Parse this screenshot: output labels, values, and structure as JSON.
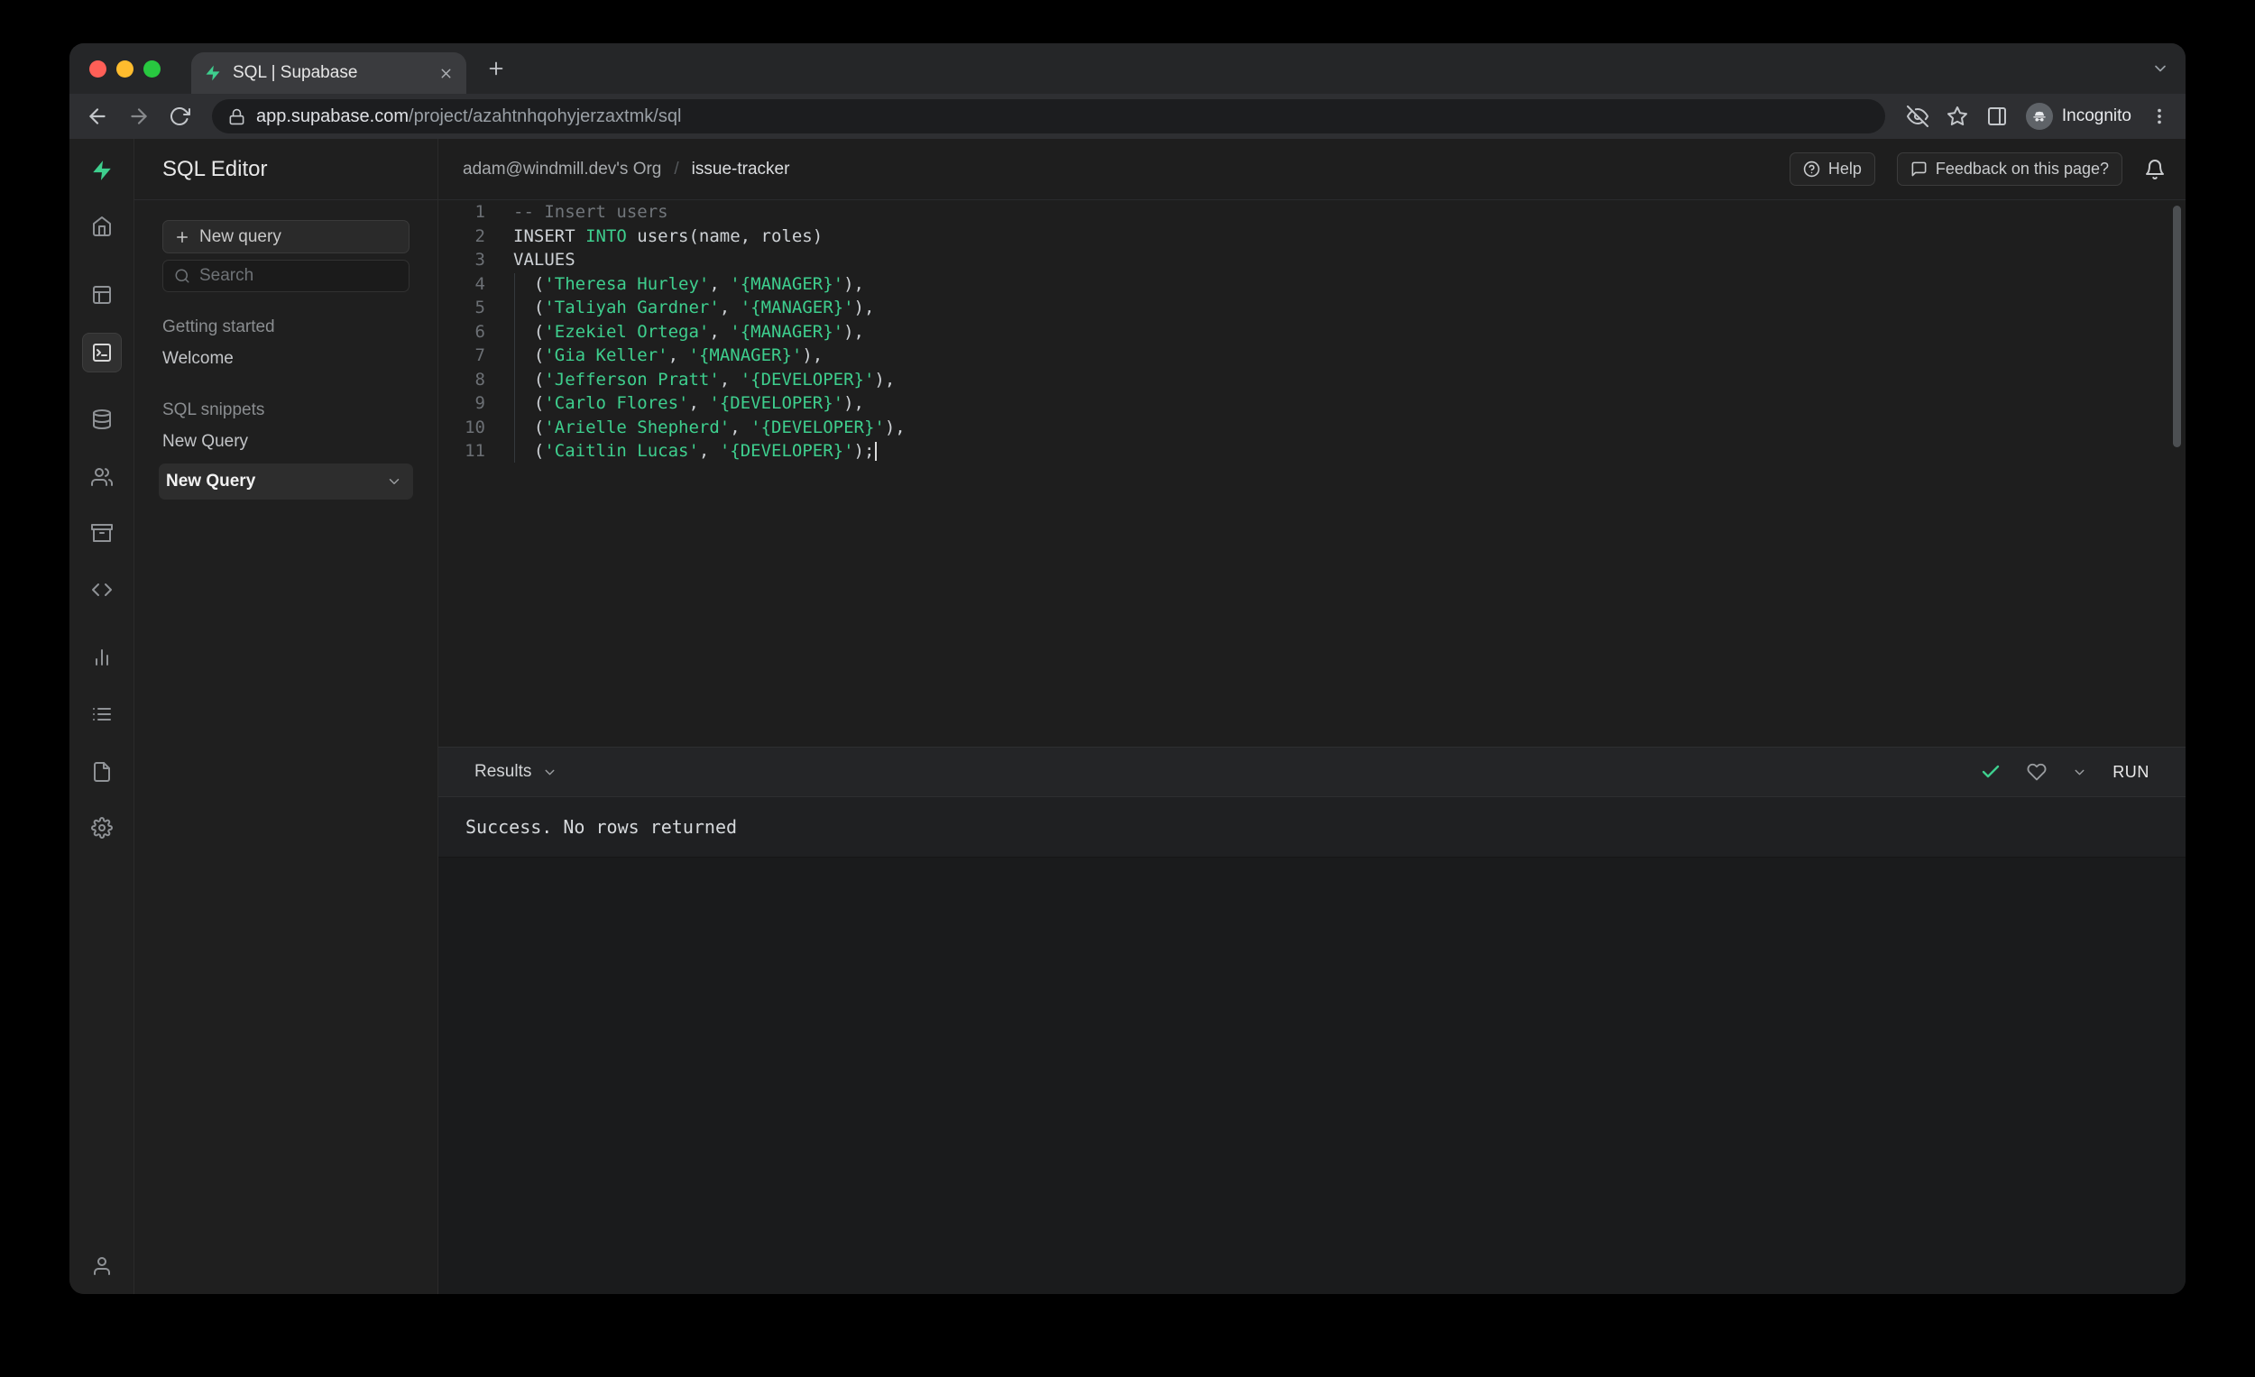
{
  "browser": {
    "tab_title": "SQL | Supabase",
    "url_domain": "app.supabase.com",
    "url_path": "/project/azahtnhqohyjerzaxtmk/sql",
    "incognito_label": "Incognito"
  },
  "sidebar": {
    "title": "SQL Editor",
    "new_query_button": "New query",
    "search_placeholder": "Search",
    "getting_started_label": "Getting started",
    "welcome_item": "Welcome",
    "snippets_label": "SQL snippets",
    "snippet_item": "New Query",
    "snippet_item_selected": "New Query"
  },
  "header": {
    "org": "adam@windmill.dev's Org",
    "separator": "/",
    "project": "issue-tracker",
    "help_label": "Help",
    "feedback_label": "Feedback on this page?"
  },
  "results": {
    "label": "Results",
    "run_label": "RUN",
    "message": "Success. No rows returned"
  },
  "colors": {
    "accent": "#3ecf8e"
  },
  "code": {
    "lines": [
      {
        "tokens": [
          [
            "c",
            "-- Insert users"
          ]
        ]
      },
      {
        "tokens": [
          [
            "p",
            "INSERT "
          ],
          [
            "k",
            "INTO"
          ],
          [
            "p",
            " users(name, roles)"
          ]
        ]
      },
      {
        "tokens": [
          [
            "p",
            "VALUES"
          ]
        ]
      },
      {
        "tokens": [
          [
            "p",
            "  ("
          ],
          [
            "s",
            "'Theresa Hurley'"
          ],
          [
            "p",
            ", "
          ],
          [
            "s",
            "'{MANAGER}'"
          ],
          [
            "p",
            "),"
          ]
        ]
      },
      {
        "tokens": [
          [
            "p",
            "  ("
          ],
          [
            "s",
            "'Taliyah Gardner'"
          ],
          [
            "p",
            ", "
          ],
          [
            "s",
            "'{MANAGER}'"
          ],
          [
            "p",
            "),"
          ]
        ]
      },
      {
        "tokens": [
          [
            "p",
            "  ("
          ],
          [
            "s",
            "'Ezekiel Ortega'"
          ],
          [
            "p",
            ", "
          ],
          [
            "s",
            "'{MANAGER}'"
          ],
          [
            "p",
            "),"
          ]
        ]
      },
      {
        "tokens": [
          [
            "p",
            "  ("
          ],
          [
            "s",
            "'Gia Keller'"
          ],
          [
            "p",
            ", "
          ],
          [
            "s",
            "'{MANAGER}'"
          ],
          [
            "p",
            "),"
          ]
        ]
      },
      {
        "tokens": [
          [
            "p",
            "  ("
          ],
          [
            "s",
            "'Jefferson Pratt'"
          ],
          [
            "p",
            ", "
          ],
          [
            "s",
            "'{DEVELOPER}'"
          ],
          [
            "p",
            "),"
          ]
        ]
      },
      {
        "tokens": [
          [
            "p",
            "  ("
          ],
          [
            "s",
            "'Carlo Flores'"
          ],
          [
            "p",
            ", "
          ],
          [
            "s",
            "'{DEVELOPER}'"
          ],
          [
            "p",
            "),"
          ]
        ]
      },
      {
        "tokens": [
          [
            "p",
            "  ("
          ],
          [
            "s",
            "'Arielle Shepherd'"
          ],
          [
            "p",
            ", "
          ],
          [
            "s",
            "'{DEVELOPER}'"
          ],
          [
            "p",
            "),"
          ]
        ]
      },
      {
        "tokens": [
          [
            "p",
            "  ("
          ],
          [
            "s",
            "'Caitlin Lucas'"
          ],
          [
            "p",
            ", "
          ],
          [
            "s",
            "'{DEVELOPER}'"
          ],
          [
            "p",
            ");"
          ]
        ],
        "cursor": true
      }
    ]
  }
}
